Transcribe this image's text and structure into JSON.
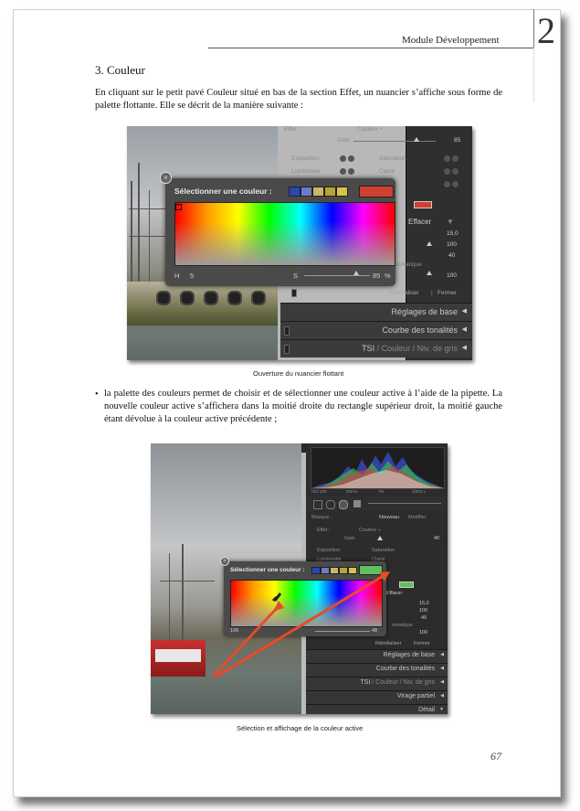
{
  "header": {
    "title": "Module Développement",
    "chapter": "2"
  },
  "section": {
    "title": "3. Couleur",
    "intro": "En cliquant sur le petit pavé Couleur situé en bas de la section Effet, un nuancier s’affiche sous forme de palette flottante. Elle se décrit de la manière suivante :"
  },
  "figure1": {
    "caption": "Ouverture du nuancier flottant",
    "picker_title": "Sélectionner une couleur :",
    "h_label": "H",
    "h_value": "5",
    "s_label": "S",
    "s_value": "85",
    "s_unit": "%",
    "panel": {
      "effet": "Effet :",
      "couleur": "Couleur ÷",
      "gain": "Gain",
      "gain_value": "85",
      "exposition": "Exposition",
      "saturation": "Saturation",
      "luminosite": "Luminosité",
      "clarte": "Clarté",
      "effacer": "Effacer",
      "v1": "15,0",
      "v2": "100",
      "v3": "40",
      "v4": "100",
      "omatique": "omatique",
      "reinitialiser": "Réinitialiser",
      "fermer": "Fermer",
      "reglages": "Réglages de base",
      "courbe": "Courbe des tonalités",
      "tsi": "TSI",
      "couleur_tab": "Couleur",
      "niv": "Niv. de gris"
    },
    "swatch_colors": [
      "#2a46b0",
      "#6b7bc8",
      "#c7b96a",
      "#b8a23a",
      "#d4c44a"
    ],
    "active_color": "#d0402f"
  },
  "bullet": {
    "text": "la palette des couleurs permet de choisir et de sélectionner une couleur active à l’aide de la pipette. La nouvelle couleur active s’affichera dans la moitié droite du rectangle supérieur droit, la moitié gauche étant dévolue à la couleur active précédente ;"
  },
  "figure2": {
    "caption": "Sélection et affichage de la couleur active",
    "picker_title": "Sélectionner une couleur :",
    "h_value": "106",
    "s_value": "48",
    "panel": {
      "masque": "Masque :",
      "nouveau": "Nouveau",
      "modifier": "Modifier",
      "effet": "Effet :",
      "couleur": "Couleur ÷",
      "gain": "Gain",
      "gain_value": "40",
      "exposition": "Exposition",
      "saturation": "Saturation",
      "luminosite": "Luminosité",
      "clarte": "Clarté",
      "effacer": "Effacer",
      "v1": "15,0",
      "v2": "100",
      "v3": "40",
      "v4": "100",
      "omatique": "omatique",
      "iso": "ISO 100",
      "mm": "50mm",
      "f": "f/8",
      "s": "1/500 s",
      "reinitialiser": "Réinitialiser",
      "fermer": "Fermer",
      "reglages": "Réglages de base",
      "courbe": "Courbe des tonalités",
      "tsi": "TSI",
      "couleur_tab": "Couleur",
      "niv": "Niv. de gris",
      "virage": "Virage partiel",
      "detail": "Détail"
    },
    "active_color": "#5fc25f"
  },
  "page_number": "67"
}
